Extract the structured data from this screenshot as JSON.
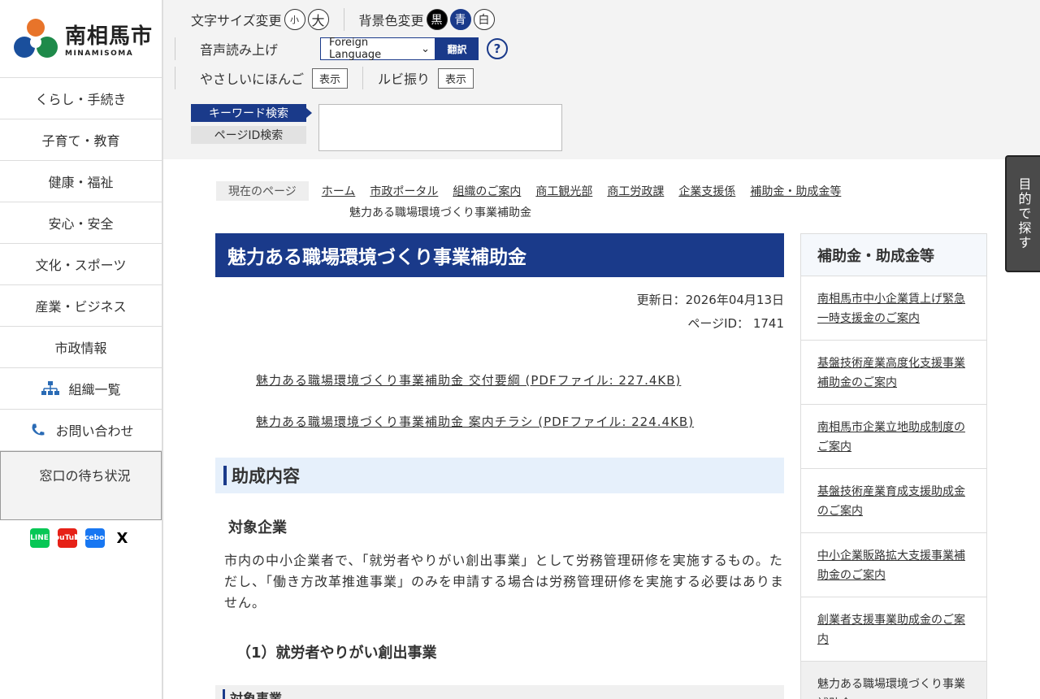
{
  "logo": {
    "name": "南相馬市",
    "sub": "MINAMISOMA"
  },
  "nav": [
    {
      "label": "くらし・手続き"
    },
    {
      "label": "子育て・教育"
    },
    {
      "label": "健康・福祉"
    },
    {
      "label": "安心・安全"
    },
    {
      "label": "文化・スポーツ"
    },
    {
      "label": "産業・ビジネス"
    },
    {
      "label": "市政情報"
    },
    {
      "label": "組織一覧",
      "icon": "org-chart-icon"
    },
    {
      "label": "お問い合わせ",
      "icon": "phone-icon"
    }
  ],
  "wait_status": "窓口の待ち状況",
  "sns": [
    "LINE",
    "YouTube",
    "Facebook",
    "X"
  ],
  "header": {
    "font_size_label": "文字サイズ変更",
    "font_small": "小",
    "font_large": "大",
    "bg_label": "背景色変更",
    "bg_black": "黒",
    "bg_blue": "青",
    "bg_white": "白",
    "voice_label": "音声読み上げ",
    "language_selected": "Foreign Language",
    "translate_btn": "翻訳",
    "help": "?",
    "easy_japanese_label": "やさしいにほんご",
    "easy_japanese_btn": "表示",
    "ruby_label": "ルビ振り",
    "ruby_btn": "表示",
    "tab_keyword": "キーワード検索",
    "tab_pageid": "ページID検索"
  },
  "side_tab": "目的で探す",
  "breadcrumb": {
    "label": "現在のページ",
    "links": [
      "ホーム",
      "市政ポータル",
      "組織のご案内",
      "商工観光部",
      "商工労政課",
      "企業支援係",
      "補助金・助成金等"
    ],
    "current": "魅力ある職場環境づくり事業補助金"
  },
  "main": {
    "title": "魅力ある職場環境づくり事業補助金",
    "updated": "更新日：2026年04月13日",
    "page_id": "ページID： 1741",
    "pdf1": "魅力ある職場環境づくり事業補助金 交付要綱 (PDFファイル: 227.4KB)",
    "pdf2": "魅力ある職場環境づくり事業補助金 案内チラシ (PDFファイル: 224.4KB)",
    "h2": "助成内容",
    "h3": "対象企業",
    "para": "市内の中小企業者で、「就労者やりがい創出事業」として労務管理研修を実施するもの。ただし、「働き方改革推進事業」のみを申請する場合は労務管理研修を実施する必要はありません。",
    "h4": "（1）就労者やりがい創出事業",
    "h5": "対象事業"
  },
  "right": {
    "heading": "補助金・助成金等",
    "items": [
      "南相馬市中小企業賃上げ緊急一時支援金のご案内",
      "基盤技術産業高度化支援事業補助金のご案内",
      "南相馬市企業立地助成制度のご案内",
      "基盤技術産業育成支援助成金のご案内",
      "中小企業販路拡大支援事業補助金のご案内",
      "創業者支援事業助成金のご案内",
      "魅力ある職場環境づくり事業補助金"
    ]
  },
  "colors": {
    "brand": "#1a3a8a",
    "h2_bg": "#e6f0fb"
  }
}
